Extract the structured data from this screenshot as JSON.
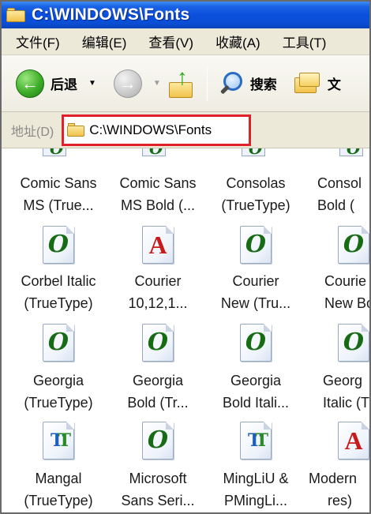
{
  "window": {
    "title": "C:\\WINDOWS\\Fonts"
  },
  "menu": [
    "文件(F)",
    "编辑(E)",
    "查看(V)",
    "收藏(A)",
    "工具(T)"
  ],
  "toolbar": {
    "back_label": "后退",
    "search_label": "搜索",
    "folders_label": "文"
  },
  "address": {
    "label": "地址(D)",
    "path": "C:\\WINDOWS\\Fonts"
  },
  "fonts": {
    "row1": [
      {
        "line1": "Comic Sans",
        "line2": "MS (True..."
      },
      {
        "line1": "Comic Sans",
        "line2": "MS Bold (..."
      },
      {
        "line1": "Consolas",
        "line2": "(TrueType)"
      },
      {
        "line1": "Consol",
        "line2": "Bold ("
      }
    ],
    "row2": [
      {
        "line1": "Corbel Italic",
        "line2": "(TrueType)",
        "icon": "opentype-icon"
      },
      {
        "line1": "Courier",
        "line2": "10,12,1...",
        "icon": "raster-font-icon"
      },
      {
        "line1": "Courier",
        "line2": "New (Tru...",
        "icon": "opentype-icon"
      },
      {
        "line1": "Courie",
        "line2": "New Bo",
        "icon": "opentype-icon"
      }
    ],
    "row3": [
      {
        "line1": "Georgia",
        "line2": "(TrueType)",
        "icon": "opentype-icon"
      },
      {
        "line1": "Georgia",
        "line2": "Bold (Tr...",
        "icon": "opentype-icon"
      },
      {
        "line1": "Georgia",
        "line2": "Bold Itali...",
        "icon": "opentype-icon"
      },
      {
        "line1": "Georg",
        "line2": "Italic (T",
        "icon": "opentype-icon"
      }
    ],
    "row4": [
      {
        "line1": "Mangal",
        "line2": "(TrueType)",
        "icon": "truetype-icon"
      },
      {
        "line1": "Microsoft",
        "line2": "Sans Seri...",
        "icon": "opentype-icon"
      },
      {
        "line1": "MingLiU &",
        "line2": "PMingLi...",
        "icon": "truetype-icon"
      },
      {
        "line1": "Modern",
        "line2": "res)",
        "icon": "raster-font-icon"
      }
    ]
  }
}
